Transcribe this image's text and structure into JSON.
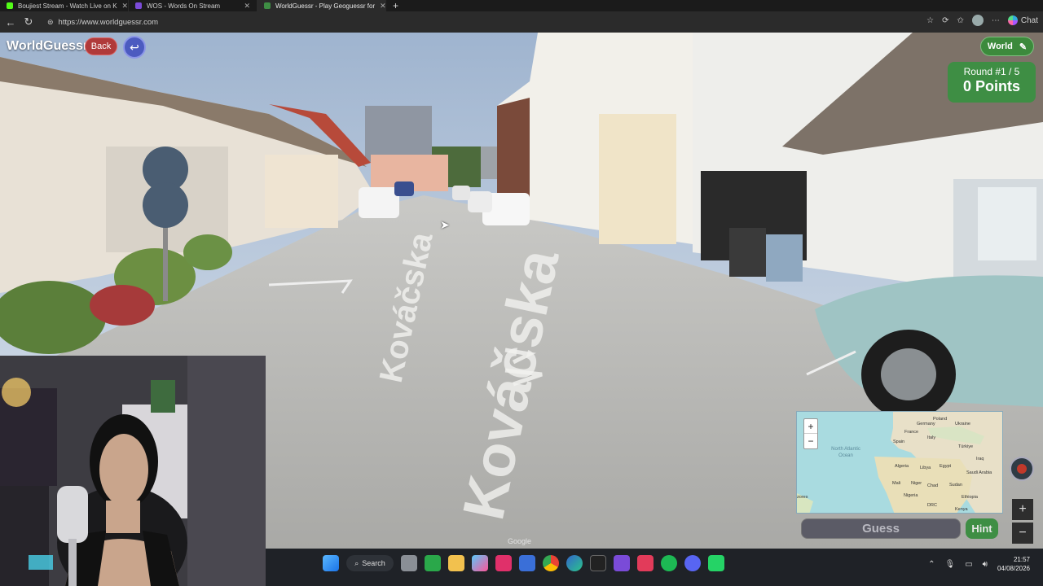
{
  "browser": {
    "tabs": [
      {
        "title": "Boujiest Stream - Watch Live on K",
        "color": "#53fc18",
        "active": false
      },
      {
        "title": "WOS - Words On Stream",
        "color": "#7b4bd8",
        "active": false
      },
      {
        "title": "WorldGuessr - Play Geoguessr for",
        "color": "#3e8e44",
        "active": true
      }
    ],
    "new_tab": "+",
    "url": "https://www.worldguessr.com",
    "chat_label": "Chat"
  },
  "game": {
    "brand": "WorldGuessr",
    "back_label": "Back",
    "world_label": "World",
    "round_label": "Round #1 / 5",
    "points_label": "0 Points",
    "guess_label": "Guess",
    "hint_label": "Hint",
    "street_text": "Kováčska",
    "watermark": "Google",
    "map": {
      "zoom_in": "+",
      "zoom_out": "−",
      "labels": {
        "germany": "Germany",
        "poland": "Poland",
        "ukraine": "Ukraine",
        "france": "France",
        "italy": "Italy",
        "spain": "Spain",
        "turkiye": "Türkiye",
        "iraq": "Iraq",
        "north_atlantic": "North Atlantic Ocean",
        "algeria": "Algeria",
        "libya": "Libya",
        "egypt": "Egypt",
        "saudi": "Saudi Arabia",
        "mali": "Mali",
        "niger": "Niger",
        "chad": "Chad",
        "sudan": "Sudan",
        "nigeria": "Nigeria",
        "ethiopia": "Ethiopia",
        "kenya": "Kenya",
        "drc": "DRC",
        "azores": "zores"
      }
    },
    "sv_zoom_in": "+",
    "sv_zoom_out": "−"
  },
  "taskbar": {
    "search_label": "Search",
    "time": "21:57",
    "date": "04/08/2026"
  }
}
